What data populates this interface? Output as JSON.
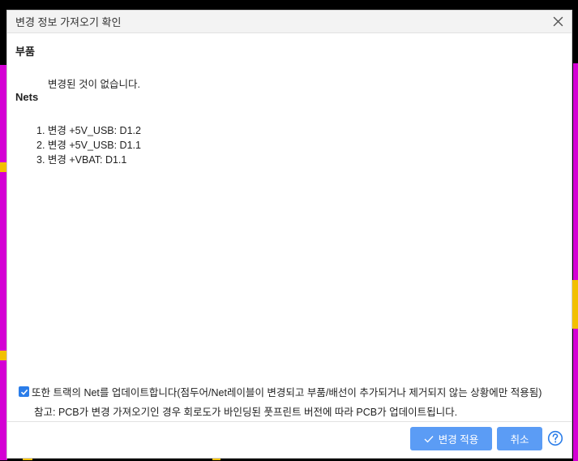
{
  "dialog": {
    "title": "변경 정보 가져오기 확인",
    "components_heading": "부품",
    "components_message": "변경된 것이 없습니다.",
    "nets_heading": "Nets",
    "nets": [
      "1. 변경 +5V_USB: D1.2",
      "2. 변경 +5V_USB: D1.1",
      "3. 변경 +VBAT: D1.1"
    ],
    "update_tracks_label": "또한 트랙의 Net를 업데이트합니다(점두어/Net레이블이 변경되고 부품/배선이 추가되거나 제거되지 않는 상황에만 적용됨)",
    "update_tracks_checked": true,
    "note": "참고: PCB가 변경 가져오기인 경우 회로도가 바인딩된 풋프린트 버전에 따라 PCB가 업데이트됩니다.",
    "apply_label": "변경 적용",
    "cancel_label": "취소"
  },
  "colors": {
    "accent": "#5b9cf5",
    "checkbox": "#2b7de9",
    "pcb_magenta": "#d400d4",
    "pcb_yellow": "#f2c000"
  },
  "icons": {
    "close": "close-icon",
    "check": "check-icon",
    "help": "help-icon"
  }
}
